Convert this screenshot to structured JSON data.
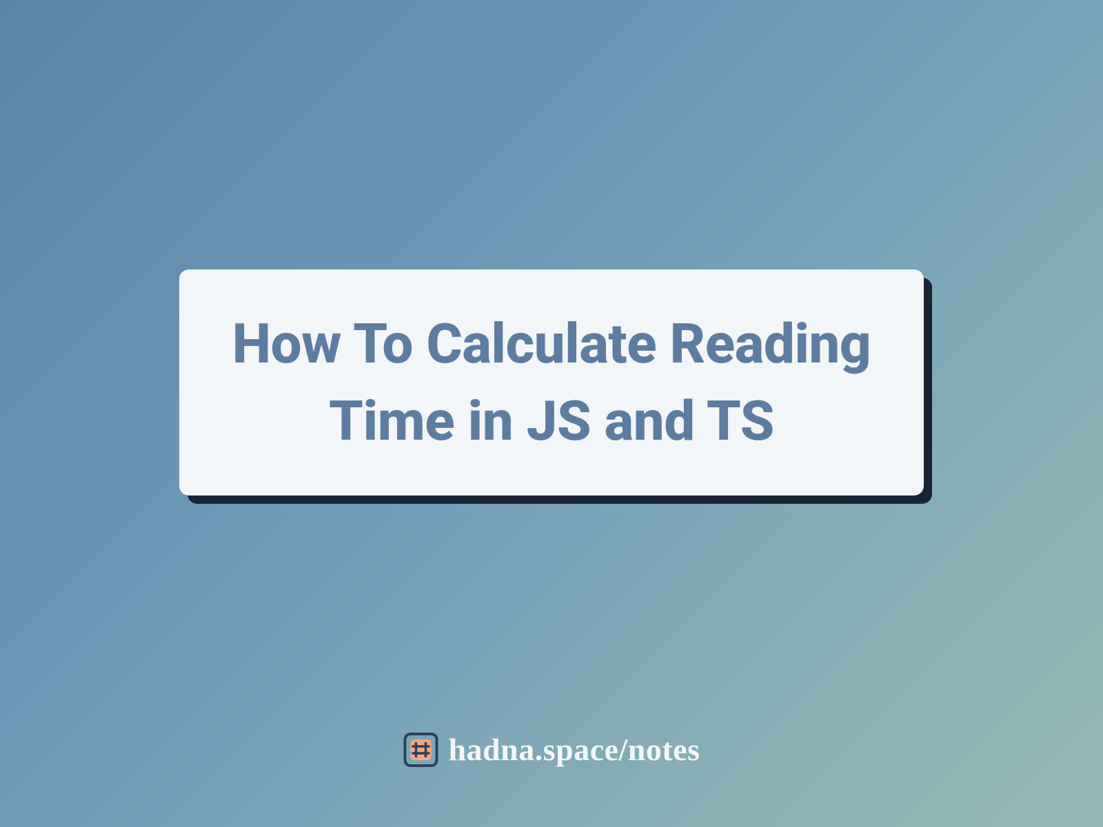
{
  "card": {
    "title": "How To Calculate Reading Time in JS and TS"
  },
  "footer": {
    "text": "hadna.space/notes"
  }
}
